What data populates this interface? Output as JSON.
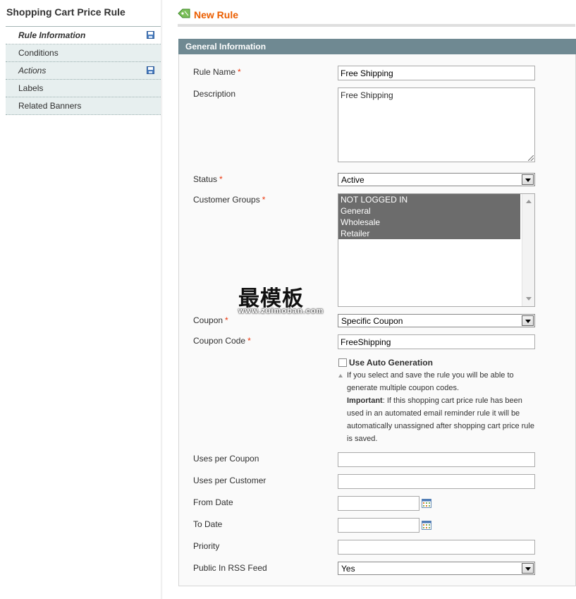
{
  "sidebar": {
    "title": "Shopping Cart Price Rule",
    "tabs": [
      {
        "label": "Rule Information"
      },
      {
        "label": "Conditions"
      },
      {
        "label": "Actions"
      },
      {
        "label": "Labels"
      },
      {
        "label": "Related Banners"
      }
    ]
  },
  "header": {
    "title": "New Rule"
  },
  "fieldset": {
    "title": "General Information"
  },
  "form": {
    "rule_name": {
      "label": "Rule Name",
      "value": "Free Shipping"
    },
    "description": {
      "label": "Description",
      "value": "Free Shipping"
    },
    "status": {
      "label": "Status",
      "value": "Active"
    },
    "customer_groups": {
      "label": "Customer Groups",
      "options": [
        "NOT LOGGED IN",
        "General",
        "Wholesale",
        "Retailer"
      ]
    },
    "coupon": {
      "label": "Coupon",
      "value": "Specific Coupon"
    },
    "coupon_code": {
      "label": "Coupon Code",
      "value": "FreeShipping"
    },
    "auto_generation": {
      "label": "Use Auto Generation",
      "note_1": "If you select and save the rule you will be able to generate multiple coupon codes.",
      "note_important_label": "Important",
      "note_2": ": If this shopping cart price rule has been used in an automated email reminder rule it will be automatically unassigned after shopping cart price rule is saved."
    },
    "uses_per_coupon": {
      "label": "Uses per Coupon",
      "value": ""
    },
    "uses_per_customer": {
      "label": "Uses per Customer",
      "value": ""
    },
    "from_date": {
      "label": "From Date",
      "value": ""
    },
    "to_date": {
      "label": "To Date",
      "value": ""
    },
    "priority": {
      "label": "Priority",
      "value": ""
    },
    "rss": {
      "label": "Public In RSS Feed",
      "value": "Yes"
    },
    "required_mark": "*"
  },
  "watermark": {
    "text": "最模板",
    "url": "www.zuimoban.com"
  },
  "colors": {
    "accent": "#eb5e00",
    "header_bar": "#6f8992",
    "required": "#eb340a",
    "selected_option": "#6c6c6c"
  }
}
